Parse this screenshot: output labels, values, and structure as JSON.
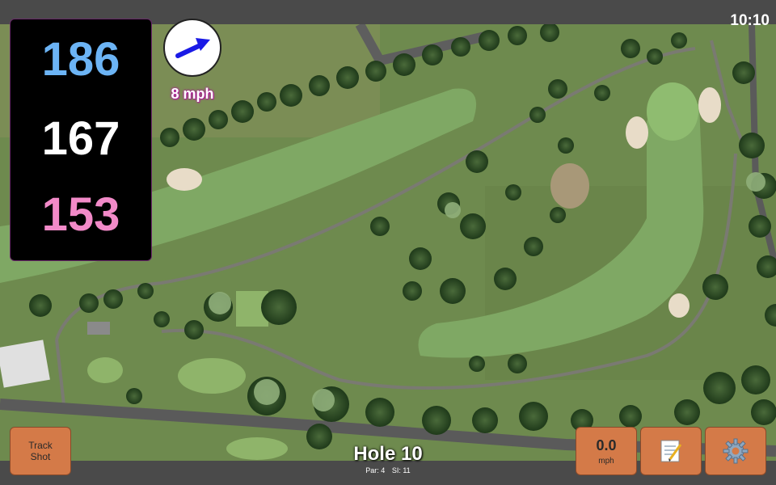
{
  "status": {
    "time": "10:10"
  },
  "distances": {
    "back": "186",
    "middle": "167",
    "front": "153"
  },
  "wind": {
    "speed_label": "8 mph",
    "icon": "wind-arrow-icon"
  },
  "buttons": {
    "track_shot_line1": "Track",
    "track_shot_line2": "Shot",
    "speed_value": "0.0",
    "speed_unit": "mph",
    "notes_icon": "notepad-icon",
    "settings_icon": "gear-icon"
  },
  "hole": {
    "title": "Hole 10",
    "par": "Par: 4",
    "si": "SI: 11"
  },
  "colors": {
    "back": "#6cb4f5",
    "middle": "#ffffff",
    "front": "#f28ac8",
    "button": "#d47a48",
    "wind_arrow": "#1a1ae6"
  }
}
